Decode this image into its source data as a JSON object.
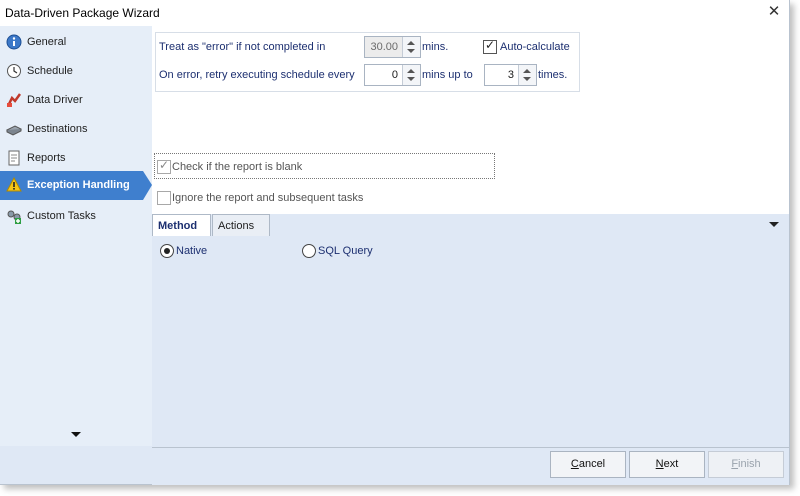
{
  "window": {
    "title": "Data-Driven Package Wizard",
    "close_glyph": "✕"
  },
  "sidebar": {
    "items": [
      {
        "label": "General",
        "icon": "info-icon"
      },
      {
        "label": "Schedule",
        "icon": "clock-icon"
      },
      {
        "label": "Data Driver",
        "icon": "data-driver-icon"
      },
      {
        "label": "Destinations",
        "icon": "destinations-icon"
      },
      {
        "label": "Reports",
        "icon": "reports-icon"
      },
      {
        "label": "Exception Handling",
        "icon": "warning-icon",
        "active": true
      },
      {
        "label": "Custom Tasks",
        "icon": "custom-tasks-icon"
      }
    ]
  },
  "timeout": {
    "treat_label": "Treat as \"error\" if not completed in",
    "value": "30.00",
    "unit": "mins.",
    "auto_calc_label": "Auto-calculate",
    "auto_calc_checked": true
  },
  "retry": {
    "label": "On error, retry  executing schedule every",
    "interval_value": "0",
    "mins_label": "mins up to",
    "times_value": "3",
    "times_label": "times."
  },
  "blank_report": {
    "check_label": "Check if the report is blank",
    "check_checked": true,
    "ignore_label": "Ignore the report and subsequent tasks",
    "ignore_checked": false
  },
  "tabs": [
    {
      "label": "Method",
      "selected": true
    },
    {
      "label": "Actions",
      "selected": false
    }
  ],
  "method": {
    "options": [
      {
        "label": "Native",
        "selected": true
      },
      {
        "label": "SQL Query",
        "selected": false
      }
    ]
  },
  "footer": {
    "cancel": {
      "prefix": "",
      "accel": "C",
      "rest": "ancel"
    },
    "next": {
      "prefix": "",
      "accel": "N",
      "rest": "ext"
    },
    "finish": {
      "prefix": "",
      "accel": "F",
      "rest": "inish"
    }
  },
  "colors": {
    "accent": "#3f7fce",
    "label_blue": "#1c2f70",
    "panel": "#dfe8f5"
  }
}
